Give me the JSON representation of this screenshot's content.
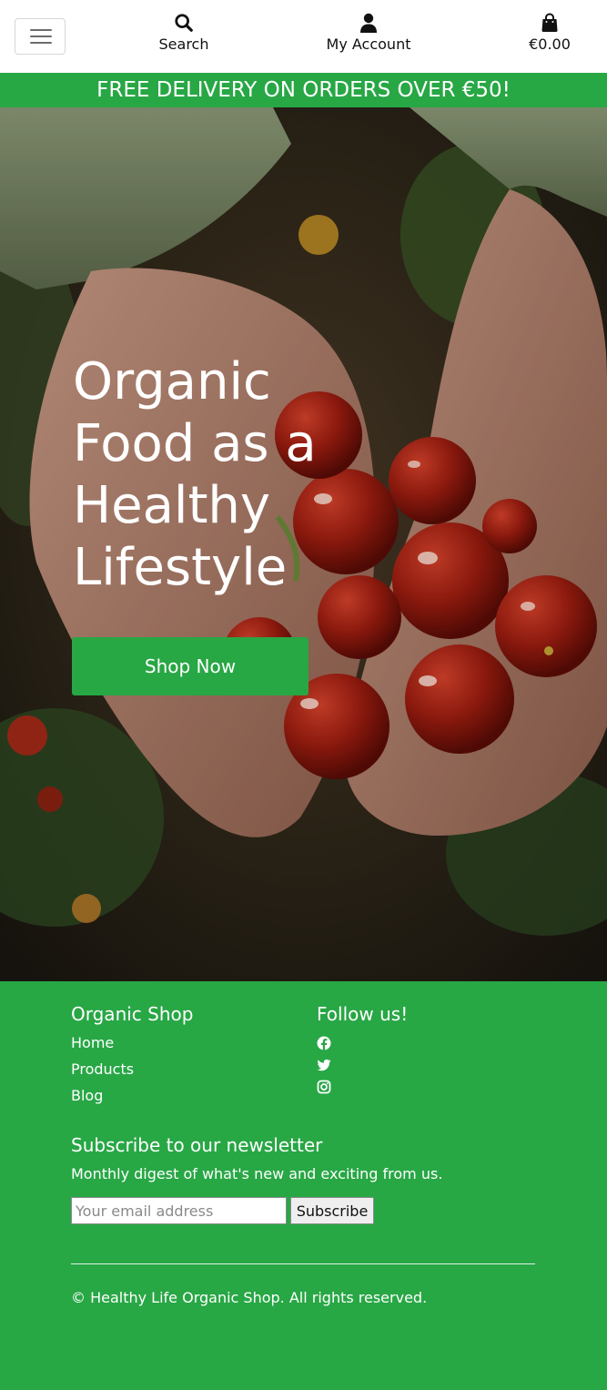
{
  "header": {
    "menu_toggle": "menu-icon",
    "search_label": "Search",
    "account_label": "My Account",
    "cart_total": "€0.00"
  },
  "banner": {
    "text": "FREE DELIVERY ON ORDERS OVER €50!"
  },
  "hero": {
    "title_lines": [
      "Organic",
      "Food as a",
      "Healthy",
      "Lifestyle"
    ],
    "cta_label": "Shop Now"
  },
  "footer": {
    "brand_heading": "Organic Shop",
    "links": [
      "Home",
      "Products",
      "Blog"
    ],
    "follow_heading": "Follow us!",
    "social_icons": [
      "facebook-icon",
      "twitter-icon",
      "instagram-icon"
    ],
    "newsletter_heading": "Subscribe to our newsletter",
    "newsletter_text": "Monthly digest of what's new and exciting from us.",
    "email_placeholder": "Your email address",
    "subscribe_label": "Subscribe",
    "copyright": "© Healthy Life Organic Shop. All rights reserved."
  },
  "colors": {
    "brand_green": "#28a745",
    "text_dark": "#111111"
  }
}
